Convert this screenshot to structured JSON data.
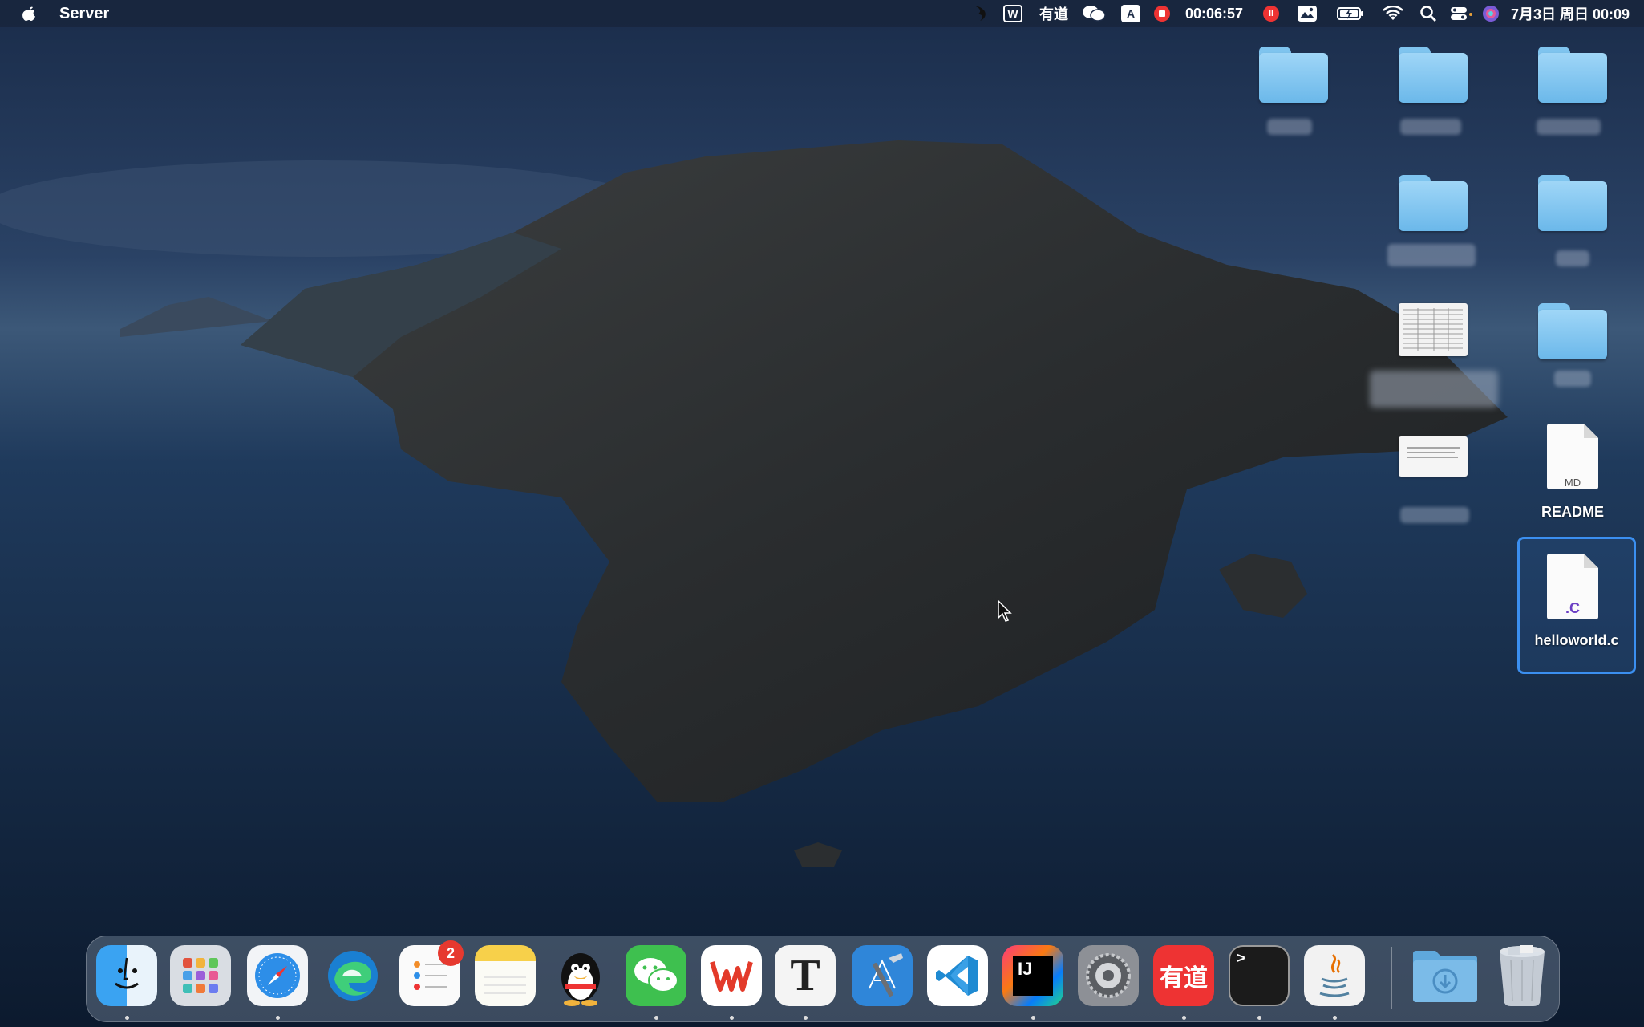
{
  "menubar": {
    "app_name": "Server",
    "youdao_label": "有道",
    "input_method": "A",
    "record_time": "00:06:57",
    "datetime": "7月3日 周日 00:09"
  },
  "desktop": {
    "readme": {
      "ext": "MD",
      "label": "README"
    },
    "helloworld": {
      "ext": ".C",
      "label": "helloworld.c"
    }
  },
  "dock": {
    "reminders_badge": "2",
    "youdao_text": "有道",
    "intellij_text": "IJ",
    "typora_text": "T",
    "terminal_prompt": ">_"
  },
  "colors": {
    "accent": "#3b8ff0",
    "folder": "#86c9f2",
    "badge": "#e6392f"
  }
}
